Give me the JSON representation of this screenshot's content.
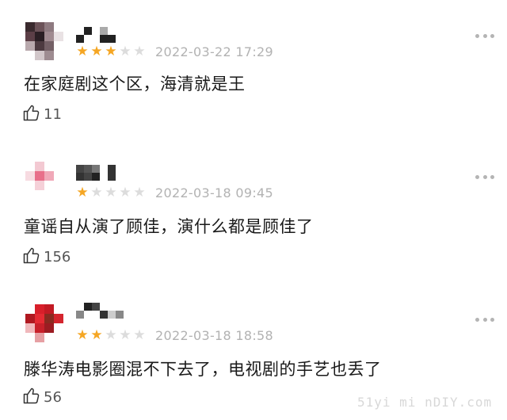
{
  "comments": [
    {
      "stars_filled": 3,
      "stars_total": 5,
      "date": "2022-03-22 17:29",
      "text": "在家庭剧这个区，海清就是王",
      "likes": "11",
      "avatar_colors": [
        "#3a2a2e",
        "#6b5258",
        "#8e7a80",
        "#ffffff",
        "#5c3f47",
        "#2b1f24",
        "#a08a90",
        "#e9e2e4",
        "#b9a9ad",
        "#4d3a40",
        "#746066",
        "#ffffff",
        "#ffffff",
        "#d2c7ca",
        "#9e8c91",
        "#ffffff"
      ],
      "name_colors": [
        "#ffffff",
        "#222222",
        "#222222",
        "#ffffff",
        "#ffffff",
        "#ffffff",
        "#aaaaaa",
        "#222222",
        "#ffffff",
        "#222222",
        "#ffffff",
        "#ffffff"
      ]
    },
    {
      "stars_filled": 1,
      "stars_total": 5,
      "date": "2022-03-18 09:45",
      "text": "童谣自从演了顾佳，演什么都是顾佳了",
      "likes": "156",
      "avatar_colors": [
        "#ffffff",
        "#f3c9d2",
        "#ffffff",
        "#ffffff",
        "#f7dbe1",
        "#e86f8a",
        "#f0a8b8",
        "#ffffff",
        "#ffffff",
        "#f5d0d8",
        "#ffffff",
        "#ffffff",
        "#ffffff",
        "#ffffff",
        "#ffffff",
        "#ffffff"
      ],
      "name_colors": [
        "#444444",
        "#333333",
        "#555555",
        "#444444",
        "#777777",
        "#222222",
        "#ffffff",
        "#ffffff",
        "#333333",
        "#333333"
      ]
    },
    {
      "stars_filled": 2,
      "stars_total": 5,
      "date": "2022-03-18 18:58",
      "text": "滕华涛电影圈混不下去了，电视剧的手艺也丢了",
      "likes": "56",
      "avatar_colors": [
        "#ffffff",
        "#d81f2a",
        "#c21a24",
        "#ffffff",
        "#b01820",
        "#e52a33",
        "#8a2a20",
        "#d4252e",
        "#f0b8bb",
        "#c8202a",
        "#9c1c22",
        "#ffffff",
        "#ffffff",
        "#e6a0a4",
        "#ffffff",
        "#ffffff"
      ],
      "name_colors": [
        "#ffffff",
        "#888888",
        "#222222",
        "#ffffff",
        "#444444",
        "#ffffff",
        "#ffffff",
        "#333333",
        "#ffffff",
        "#cccccc",
        "#ffffff",
        "#888888"
      ]
    }
  ],
  "watermark": "51yi mi nDIY.com",
  "colors": {
    "star_on": "#f5a623",
    "star_off": "#dcdcdc",
    "date": "#b2b2b2"
  },
  "icons": {
    "rating": "star-icon",
    "like": "thumbs-up-icon",
    "more": "more-dots-icon"
  }
}
